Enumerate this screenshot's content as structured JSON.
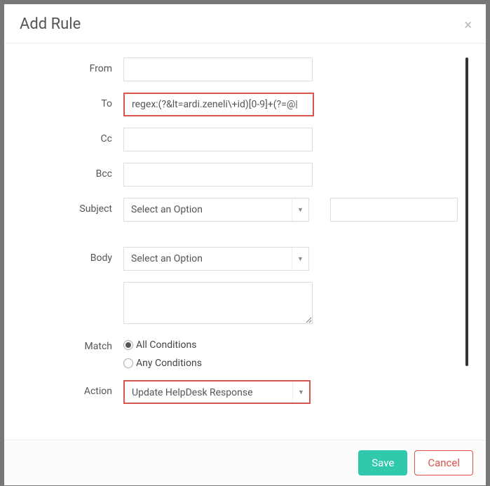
{
  "modal": {
    "title": "Add Rule"
  },
  "labels": {
    "from": "From",
    "to": "To",
    "cc": "Cc",
    "bcc": "Bcc",
    "subject": "Subject",
    "body": "Body",
    "match": "Match",
    "action": "Action"
  },
  "values": {
    "from": "",
    "to": "regex:(?&lt=ardi.zeneli\\+id)[0-9]+(?=@|",
    "cc": "",
    "bcc": "",
    "subject_select": "Select an Option",
    "subject_text": "",
    "body_select": "Select an Option",
    "body_text": "",
    "action_select": "Update HelpDesk Response"
  },
  "match_options": {
    "all": "All Conditions",
    "any": "Any Conditions"
  },
  "footer": {
    "save": "Save",
    "cancel": "Cancel"
  }
}
